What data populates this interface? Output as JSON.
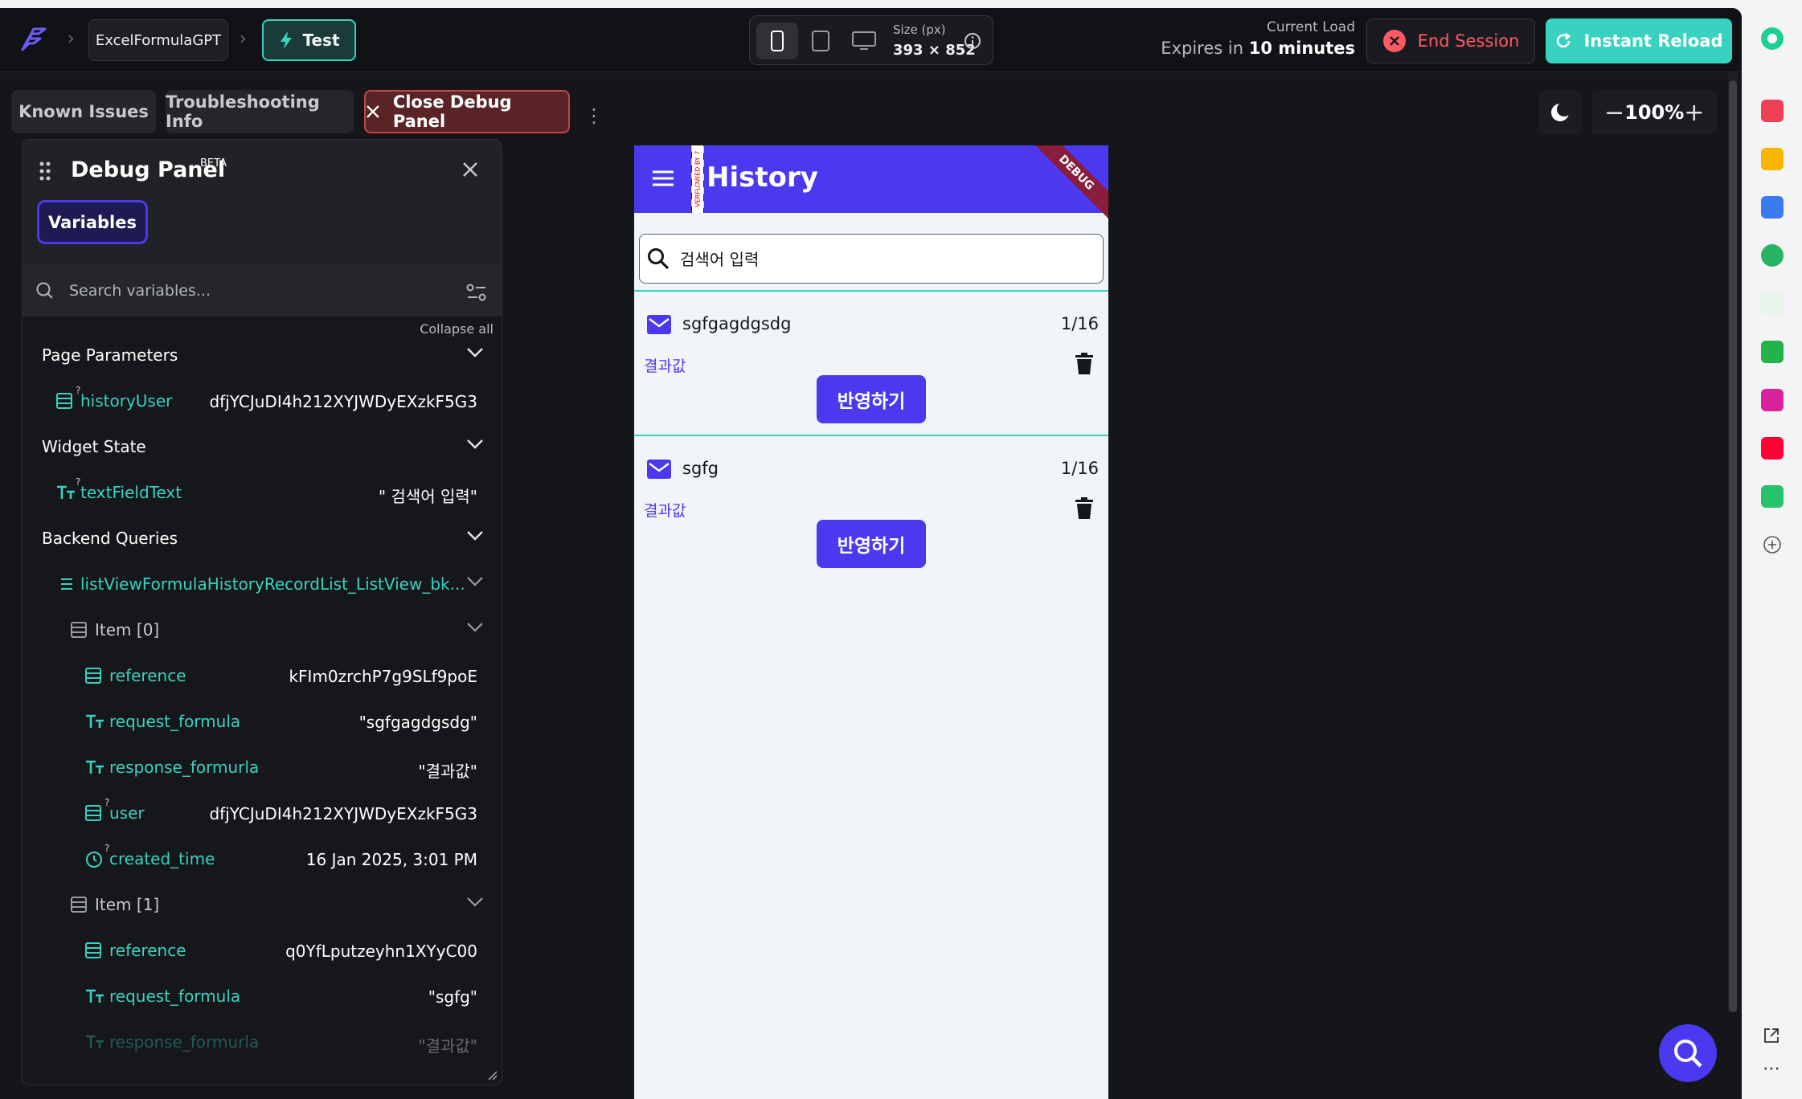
{
  "topbar": {
    "project_name": "ExcelFormulaGPT",
    "test_label": "Test",
    "size_label": "Size (px)",
    "size_value": "393 × 852",
    "load_label": "Current Load",
    "expires_prefix": "Expires in",
    "expires_value": "10 minutes",
    "end_session": "End Session",
    "instant_reload": "Instant Reload"
  },
  "toolbar": {
    "known_issues": "Known Issues",
    "troubleshooting": "Troubleshooting Info",
    "close_debug": "Close Debug Panel",
    "zoom": "100%",
    "zoom_minus": "−",
    "zoom_plus": "+"
  },
  "debug_panel": {
    "title": "Debug Panel",
    "beta": "BETA",
    "tab": "Variables",
    "search_placeholder": "Search variables...",
    "collapse_all": "Collapse all",
    "page_parameters": "Page Parameters",
    "history_user_name": "historyUser",
    "history_user_value": "dfjYCJuDI4h212XYJWDyEXzkF5G3",
    "widget_state": "Widget State",
    "text_field_name": "textFieldText",
    "text_field_value": "\"     검색어 입력\"",
    "backend_queries": "Backend Queries",
    "query_name": "listViewFormulaHistoryRecordList_ListView_bk...",
    "items": [
      {
        "label": "Item [0]",
        "reference": "kFIm0zrchP7g9SLf9poE",
        "request_formula": "\"sgfgagdgsdg\"",
        "response_formurla": "\"결과값\"",
        "user": "dfjYCJuDI4h212XYJWDyEXzkF5G3",
        "created_time": "16 Jan 2025, 3:01 PM"
      },
      {
        "label": "Item [1]",
        "reference": "q0YfLputzeyhn1XYyC00",
        "request_formula": "\"sgfg\"",
        "response_formurla": "\"결과값\""
      }
    ],
    "field_names": {
      "reference": "reference",
      "request_formula": "request_formula",
      "response_formurla": "response_formurla",
      "user": "user",
      "created_time": "created_time"
    }
  },
  "phone": {
    "title": "History",
    "overflow_text": "VERFLOWED BY 7",
    "debug_ribbon": "DEBUG",
    "search_placeholder": "검색어 입력",
    "cards": [
      {
        "title": "sgfgagdgsdg",
        "count": "1/16",
        "result": "결과값",
        "button": "반영하기"
      },
      {
        "title": "sgfg",
        "count": "1/16",
        "result": "결과값",
        "button": "반영하기"
      }
    ]
  },
  "colors": {
    "primary": "#4b39ef",
    "accent": "#39d2c0",
    "danger": "#ff5963"
  },
  "icons": [
    "flutterflow-logo",
    "bolt-icon",
    "phone-icon",
    "tablet-icon",
    "desktop-icon",
    "info-icon",
    "close-circle-icon",
    "reload-icon",
    "close-icon",
    "more-vert-icon",
    "moon-icon",
    "drag-icon",
    "search-icon",
    "filter-icon",
    "chevron-down-icon",
    "document-icon",
    "text-icon",
    "clock-icon",
    "list-icon",
    "menu-icon",
    "mail-icon",
    "trash-icon"
  ]
}
